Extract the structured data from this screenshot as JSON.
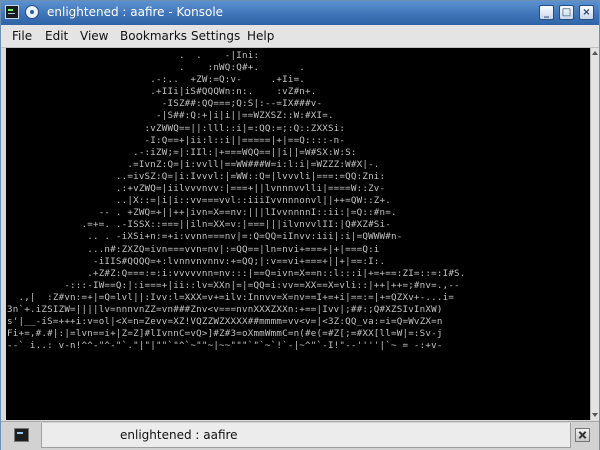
{
  "window": {
    "title": "enlightened : aafire - Konsole",
    "minimize_glyph": "_",
    "maximize_glyph": "□",
    "close_glyph": "×"
  },
  "menu": {
    "items": [
      "File",
      "Edit",
      "View",
      "Bookmarks",
      "Settings",
      "Help"
    ]
  },
  "terminal": {
    "background": "#000000",
    "foreground": "#c2c2c2",
    "text": "                              .  .    -|Ini:\n                              .    :nWQ:Q#+.       .\n                         .-:..  +ZW:=Q:v-     .+Ii=.\n                         .+IIi|iS#QQQWn:n:.    :vZ#n+.\n                           -ISZ##:QQ===;Q:S|:--=IX###v-\n                          -|S##:Q:+|i|i||==WZXSZ::W:#XI=.\n                        :vZWWQ==||:lll::i|=:QQ:=;:Q::ZXXSi:\n                        -I:Q==+|ii:l::i||=====|+|==Q::::-n-\n                      .-:iZW;=|:IIl:|+===WQQ==||i||=W#SX:W:S:\n                     .=IvnZ:Q=|i:vvll|==WW###W=i:l:i|=WZZZ:W#X|-.\n                   ..=ivSZ:Q=|i:Ivvvl:|=WW::Q=|lvvvli|===:=QQ:Zni:\n                   .:+vZWQ=|iilvvvnvv:|===+||lvnnnvvlli|====W::Zv-\n                   ..|X::=|i|i::vv===vvl::iiiIvvnnnonvl||++=QW::Z+.\n                -- . +ZWQ=+||++|ivn=X==nv:|||lIvvnnnnI::ii:|=Q::#n=.\n             .=+=. .-ISSX::===||iln=XX=v:|===|||ilvnvvlII:|Q#XZ#Si-\n              .. . -iXSi+n:=+i:vvnn===nv|=:Q=QQ=iInvv:iii|:i|=QWWW#n-\n              ...n#:ZXZQ=ivn===vvn=nv|:=QQ==|ln=nvi+===+|+|===Q:i\n               -iIIS#QQQQ=+:lvnnvnvnnv:+=QQ;|:v==vi+===+||+|==:I:.\n              .+Z#Z:Q===:=:i:vvvvvnn=nv:::|==Q=ivn=X==n::l:::i|+=+==:ZI=::=:I#S.\n          -:::-IW==Q:|:i===+|ii::lv=XXn|=|=QQ=i:vv==XX==X=vli::|++|++=;#nv=.,--\n  .,|  :Z#vn:=+|=Q=lvl||:Ivv:l=XXX=v+=ilv:Innvv=X=nv==I+=+i|==:=|+=QZXv+-...i=\n3n`+.iZSIZW=||||lv=nnnvnZZ=vn###Znv<v===nvnXXXZXXn:+==|Ivv|;##:;Q#XZSIvInXW)\ns'|__-iS=+++i:v=ol|<X=n=Zevv=XZ!VQZZWZXXXX##mmmm=vv<v=|<3Z:QQ_va:=i=Q=WvZX=n\nFi+=,#.#|:|=lvn==i+|Z=Z]#lIvnnC=vQ>]#Z#3=oXmmWmmC=n(#e(=#Z[;=#XX[ll=W|=:Sv-j\n--` i..: v-n!^^-\"^-\"`.\"|\"|\"\"`\"^`~\"\"~|~~\"\"\"`\"`~`!`-|~^\"`-I!\"--''''|`~ = -:+v-"
  },
  "tab": {
    "label": "enlightened : aafire"
  },
  "colors": {
    "titlebar": "#3f75b8",
    "terminal_bg": "#000000",
    "terminal_fg": "#c2c2c2"
  }
}
